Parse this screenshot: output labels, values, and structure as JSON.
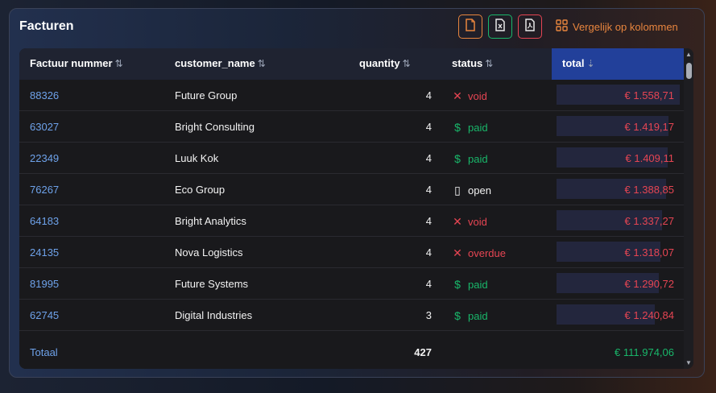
{
  "title": "Facturen",
  "toolbar": {
    "compare_label": "Vergelijk op kolommen",
    "icons": [
      "file-icon",
      "excel-icon",
      "pdf-icon",
      "columns-icon"
    ],
    "colors": {
      "orange": "#e8853e",
      "green": "#19b76a",
      "red": "#e64553"
    }
  },
  "columns": {
    "invoice": "Factuur nummer",
    "customer": "customer_name",
    "quantity": "quantity",
    "status": "status",
    "total": "total"
  },
  "rows": [
    {
      "invoice": "88326",
      "customer": "Future Group",
      "quantity": "4",
      "status": "void",
      "status_icon": "x-icon",
      "total": "€ 1.558,71",
      "total_value": 1558.71
    },
    {
      "invoice": "63027",
      "customer": "Bright Consulting",
      "quantity": "4",
      "status": "paid",
      "status_icon": "dollar-icon",
      "total": "€ 1.419,17",
      "total_value": 1419.17
    },
    {
      "invoice": "22349",
      "customer": "Luuk Kok",
      "quantity": "4",
      "status": "paid",
      "status_icon": "dollar-icon",
      "total": "€ 1.409,11",
      "total_value": 1409.11
    },
    {
      "invoice": "76267",
      "customer": "Eco Group",
      "quantity": "4",
      "status": "open",
      "status_icon": "document-icon",
      "total": "€ 1.388,85",
      "total_value": 1388.85
    },
    {
      "invoice": "64183",
      "customer": "Bright Analytics",
      "quantity": "4",
      "status": "void",
      "status_icon": "x-icon",
      "total": "€ 1.337,27",
      "total_value": 1337.27
    },
    {
      "invoice": "24135",
      "customer": "Nova Logistics",
      "quantity": "4",
      "status": "overdue",
      "status_icon": "x-icon",
      "total": "€ 1.318,07",
      "total_value": 1318.07
    },
    {
      "invoice": "81995",
      "customer": "Future Systems",
      "quantity": "4",
      "status": "paid",
      "status_icon": "dollar-icon",
      "total": "€ 1.290,72",
      "total_value": 1290.72
    },
    {
      "invoice": "62745",
      "customer": "Digital Industries",
      "quantity": "3",
      "status": "paid",
      "status_icon": "dollar-icon",
      "total": "€ 1.240,84",
      "total_value": 1240.84
    }
  ],
  "footer": {
    "label": "Totaal",
    "quantity": "427",
    "total": "€ 111.974,06"
  }
}
